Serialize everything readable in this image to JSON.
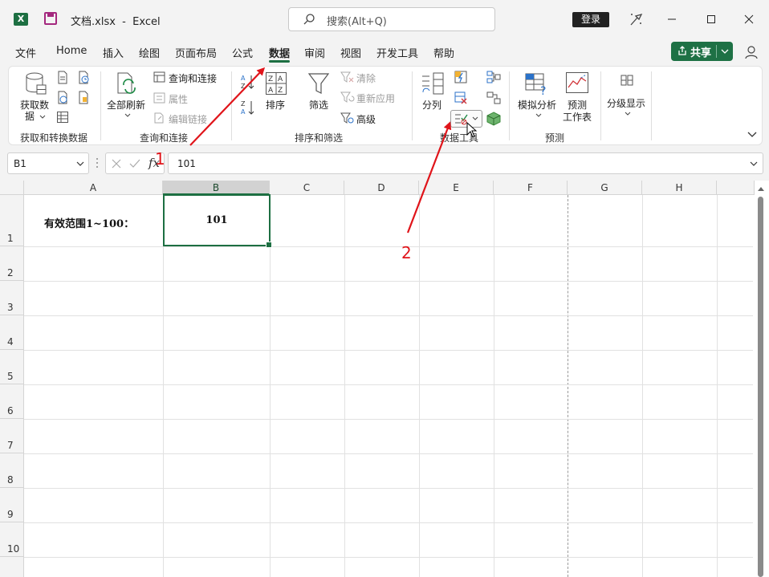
{
  "titlebar": {
    "file_name": "文档.xlsx",
    "separator": "-",
    "app_name": "Excel",
    "search_placeholder": "搜索(Alt+Q)",
    "login_label": "登录"
  },
  "menu": {
    "tabs": [
      {
        "label": "文件"
      },
      {
        "label": "Home"
      },
      {
        "label": "插入"
      },
      {
        "label": "绘图"
      },
      {
        "label": "页面布局"
      },
      {
        "label": "公式"
      },
      {
        "label": "数据",
        "active": true
      },
      {
        "label": "审阅"
      },
      {
        "label": "视图"
      },
      {
        "label": "开发工具"
      },
      {
        "label": "帮助"
      }
    ],
    "share_label": "共享"
  },
  "ribbon": {
    "get_data": {
      "label_line1": "获取数",
      "label_line2": "据",
      "group_label": "获取和转换数据"
    },
    "queries": {
      "refresh_all_label": "全部刷新",
      "queries_connections_label": "查询和连接",
      "properties_label": "属性",
      "edit_links_label": "编辑链接",
      "group_label": "查询和连接"
    },
    "sort_filter": {
      "sort_label": "排序",
      "filter_label": "筛选",
      "clear_label": "清除",
      "reapply_label": "重新应用",
      "advanced_label": "高级",
      "group_label": "排序和筛选"
    },
    "data_tools": {
      "text_to_columns_label": "分列",
      "group_label": "数据工具"
    },
    "forecast": {
      "what_if_label": "模拟分析",
      "forecast_sheet_line1": "预测",
      "forecast_sheet_line2": "工作表",
      "group_label": "预测"
    },
    "outline": {
      "label": "分级显示"
    }
  },
  "formula_bar": {
    "name_box": "B1",
    "fx_label": "fx",
    "content": "101"
  },
  "sheet": {
    "columns": [
      "A",
      "B",
      "C",
      "D",
      "E",
      "F",
      "G",
      "H"
    ],
    "rows": [
      "1",
      "2",
      "3",
      "4",
      "5",
      "6",
      "7",
      "8",
      "9",
      "10"
    ],
    "cell_a1": "有效范围1~100：",
    "cell_b1": "101"
  },
  "annotations": {
    "marker1": "1",
    "marker2": "2",
    "color": "#e0141a"
  },
  "colors": {
    "accent": "#1d6f42"
  }
}
